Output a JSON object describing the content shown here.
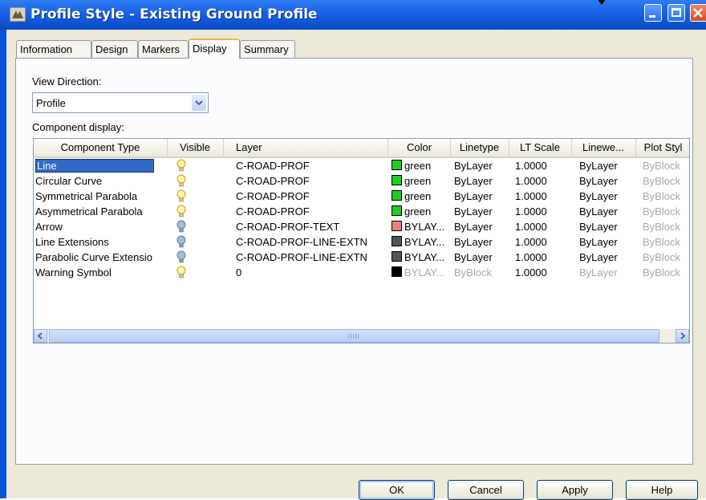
{
  "window": {
    "title": "Profile Style - Existing Ground Profile"
  },
  "tabs": [
    {
      "label": "Information",
      "active": false
    },
    {
      "label": "Design",
      "active": false
    },
    {
      "label": "Markers",
      "active": false
    },
    {
      "label": "Display",
      "active": true
    },
    {
      "label": "Summary",
      "active": false
    }
  ],
  "view_direction": {
    "label": "View Direction:",
    "value": "Profile"
  },
  "component_display": {
    "label": "Component display:",
    "columns": [
      "Component Type",
      "Visible",
      "Layer",
      "Color",
      "Linetype",
      "LT Scale",
      "Linewe...",
      "Plot Styl"
    ],
    "rows": [
      {
        "type": "Line",
        "visible": "on",
        "layer": "C-ROAD-PROF",
        "color": "green",
        "color_hex": "#22cc22",
        "linetype": "ByLayer",
        "lt_scale": "1.0000",
        "lineweight": "ByLayer",
        "plot_style": "ByBlock",
        "selected": true
      },
      {
        "type": "Circular Curve",
        "visible": "on",
        "layer": "C-ROAD-PROF",
        "color": "green",
        "color_hex": "#22cc22",
        "linetype": "ByLayer",
        "lt_scale": "1.0000",
        "lineweight": "ByLayer",
        "plot_style": "ByBlock"
      },
      {
        "type": "Symmetrical Parabola",
        "visible": "on",
        "layer": "C-ROAD-PROF",
        "color": "green",
        "color_hex": "#22cc22",
        "linetype": "ByLayer",
        "lt_scale": "1.0000",
        "lineweight": "ByLayer",
        "plot_style": "ByBlock"
      },
      {
        "type": "Asymmetrical Parabola",
        "visible": "on",
        "layer": "C-ROAD-PROF",
        "color": "green",
        "color_hex": "#22cc22",
        "linetype": "ByLayer",
        "lt_scale": "1.0000",
        "lineweight": "ByLayer",
        "plot_style": "ByBlock"
      },
      {
        "type": "Arrow",
        "visible": "off",
        "layer": "C-ROAD-PROF-TEXT",
        "color": "BYLAY...",
        "color_hex": "#f08080",
        "linetype": "ByLayer",
        "lt_scale": "1.0000",
        "lineweight": "ByLayer",
        "plot_style": "ByBlock"
      },
      {
        "type": "Line Extensions",
        "visible": "off",
        "layer": "C-ROAD-PROF-LINE-EXTN",
        "color": "BYLAY...",
        "color_hex": "#555555",
        "linetype": "ByLayer",
        "lt_scale": "1.0000",
        "lineweight": "ByLayer",
        "plot_style": "ByBlock"
      },
      {
        "type": "Parabolic Curve Extensio",
        "visible": "off",
        "layer": "C-ROAD-PROF-LINE-EXTN",
        "color": "BYLAY...",
        "color_hex": "#555555",
        "linetype": "ByLayer",
        "lt_scale": "1.0000",
        "lineweight": "ByLayer",
        "plot_style": "ByBlock"
      },
      {
        "type": "Warning Symbol",
        "visible": "on",
        "layer": "0",
        "color": "BYLAY...",
        "color_hex": "#000000",
        "linetype": "ByBlock",
        "lt_scale": "1.0000",
        "lineweight": "ByLayer",
        "plot_style": "ByBlock",
        "grayed": true
      }
    ]
  },
  "buttons": {
    "ok": "OK",
    "cancel": "Cancel",
    "apply": "Apply",
    "help": "Help"
  },
  "colors": {
    "title_bar": "#0a52d6",
    "dialog_bg": "#ece9d8",
    "selection": "#316ac5"
  }
}
